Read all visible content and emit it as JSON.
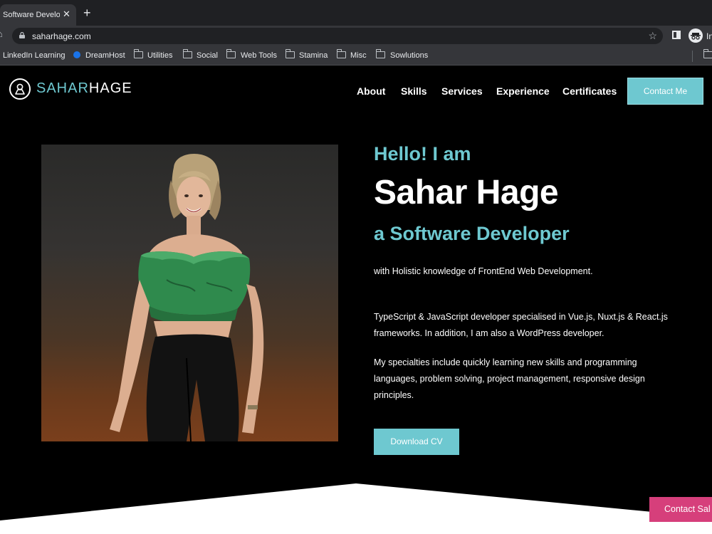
{
  "browser": {
    "tab_title": "Software Develop",
    "tab_close": "✕",
    "new_tab": "+",
    "url": "saharhage.com",
    "profile_label": "In",
    "bookmarks": [
      {
        "label": "LinkedIn Learning",
        "icon": "none"
      },
      {
        "label": "DreamHost",
        "icon": "dreamhost-icon"
      },
      {
        "label": "Utilities",
        "icon": "folder-icon"
      },
      {
        "label": "Social",
        "icon": "folder-icon"
      },
      {
        "label": "Web Tools",
        "icon": "folder-icon"
      },
      {
        "label": "Stamina",
        "icon": "folder-icon"
      },
      {
        "label": "Misc",
        "icon": "folder-icon"
      },
      {
        "label": "Sowlutions",
        "icon": "folder-icon"
      }
    ]
  },
  "site": {
    "logo": {
      "first": "SAHAR",
      "last": "HAGE"
    },
    "nav": [
      "About",
      "Skills",
      "Services",
      "Experience",
      "Certificates"
    ],
    "contact_button": "Contact Me",
    "hero": {
      "greeting": "Hello! I am",
      "name": "Sahar Hage",
      "role": "a Software Developer",
      "paragraphs": [
        "with Holistic knowledge of FrontEnd Web Development.",
        "TypeScript & JavaScript developer specialised in Vue.js, Nuxt.js & React.js frameworks. In addition, I am also a WordPress developer.",
        "My specialties include quickly learning new skills and programming languages, problem solving, project management, responsive design principles."
      ],
      "download_button": "Download CV"
    },
    "floating_contact": "Contact Sal",
    "colors": {
      "accent": "#6ec8d0",
      "pink": "#d63f7b",
      "background": "#000000"
    }
  }
}
